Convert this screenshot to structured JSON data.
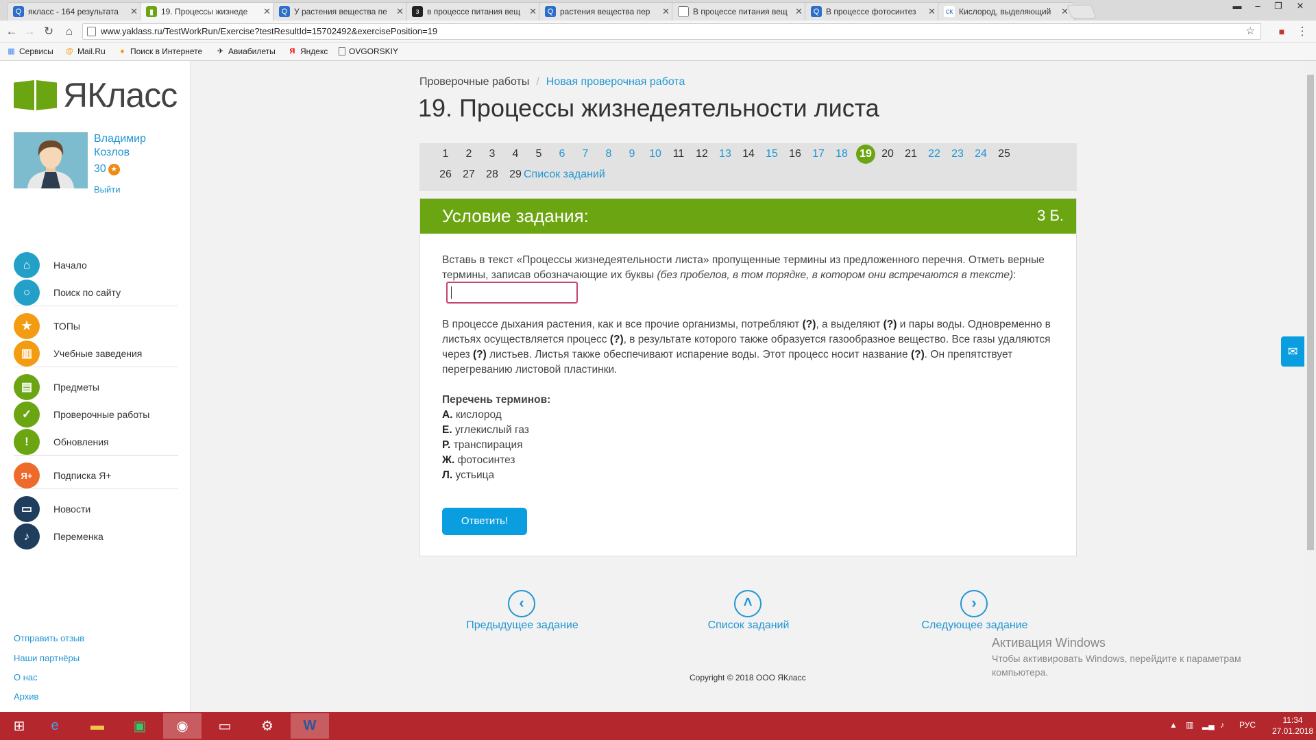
{
  "browser": {
    "tabs": [
      {
        "title": "якласс - 164 результата",
        "icon": "search-icon",
        "active": false
      },
      {
        "title": "19. Процессы жизнеде",
        "icon": "yaklass-icon",
        "active": true
      },
      {
        "title": "У растения вещества пе",
        "icon": "search-icon",
        "active": false
      },
      {
        "title": "в процессе питания вещ",
        "icon": "z-icon",
        "active": false
      },
      {
        "title": "растения вещества пер",
        "icon": "search-icon",
        "active": false
      },
      {
        "title": "В процессе питания вещ",
        "icon": "document-icon",
        "active": false
      },
      {
        "title": "В процессе фотосинтез",
        "icon": "search-icon",
        "active": false
      },
      {
        "title": "Кислород, выделяющий",
        "icon": "sk-icon",
        "active": false
      }
    ],
    "url": "www.yaklass.ru/TestWorkRun/Exercise?testResultId=15702492&exercisePosition=19",
    "bookmarks": [
      "Сервисы",
      "Mail.Ru",
      "Поиск в Интернете",
      "Авиабилеты",
      "Яндекс",
      "OVGORSKIY"
    ]
  },
  "sidebar": {
    "logo_text": "ЯКласс",
    "user_name": "Владимир Козлов",
    "user_points": "30",
    "logout": "Выйти",
    "menu": [
      {
        "label": "Начало",
        "icon": "home-icon",
        "color": "#22a0c8"
      },
      {
        "label": "Поиск по сайту",
        "icon": "search-icon",
        "color": "#22a0c8"
      },
      {
        "label": "ТОПы",
        "icon": "star-icon",
        "color": "#f39c12"
      },
      {
        "label": "Учебные заведения",
        "icon": "building-icon",
        "color": "#f39c12"
      },
      {
        "label": "Предметы",
        "icon": "book-icon",
        "color": "#6ba512"
      },
      {
        "label": "Проверочные работы",
        "icon": "check-icon",
        "color": "#6ba512"
      },
      {
        "label": "Обновления",
        "icon": "exclamation-icon",
        "color": "#6ba512"
      },
      {
        "label": "Подписка Я+",
        "icon": "yaplus-icon",
        "color": "#ee6a2a"
      },
      {
        "label": "Новости",
        "icon": "chat-icon",
        "color": "#1f3d5c"
      },
      {
        "label": "Переменка",
        "icon": "bell-icon",
        "color": "#1f3d5c"
      }
    ],
    "footer_links": [
      "Отправить отзыв",
      "Наши партнёры",
      "О нас",
      "Архив"
    ]
  },
  "breadcrumb": {
    "first": "Проверочные работы",
    "separator": "/",
    "second": "Новая проверочная работа"
  },
  "page_title": "19. Процессы жизнедеятельности листа",
  "pager": {
    "numbers": [
      {
        "n": "1",
        "state": "done"
      },
      {
        "n": "2",
        "state": "done"
      },
      {
        "n": "3",
        "state": "done"
      },
      {
        "n": "4",
        "state": "done"
      },
      {
        "n": "5",
        "state": "done"
      },
      {
        "n": "6",
        "state": "todo"
      },
      {
        "n": "7",
        "state": "todo"
      },
      {
        "n": "8",
        "state": "todo"
      },
      {
        "n": "9",
        "state": "todo"
      },
      {
        "n": "10",
        "state": "todo"
      },
      {
        "n": "11",
        "state": "done"
      },
      {
        "n": "12",
        "state": "done"
      },
      {
        "n": "13",
        "state": "todo"
      },
      {
        "n": "14",
        "state": "done"
      },
      {
        "n": "15",
        "state": "todo"
      },
      {
        "n": "16",
        "state": "done"
      },
      {
        "n": "17",
        "state": "todo"
      },
      {
        "n": "18",
        "state": "todo"
      },
      {
        "n": "19",
        "state": "current"
      },
      {
        "n": "20",
        "state": "done"
      },
      {
        "n": "21",
        "state": "done"
      },
      {
        "n": "22",
        "state": "todo"
      },
      {
        "n": "23",
        "state": "todo"
      },
      {
        "n": "24",
        "state": "todo"
      },
      {
        "n": "25",
        "state": "done"
      },
      {
        "n": "26",
        "state": "done"
      },
      {
        "n": "27",
        "state": "done"
      },
      {
        "n": "28",
        "state": "done"
      },
      {
        "n": "29",
        "state": "done"
      }
    ],
    "list_link": "Список заданий"
  },
  "task": {
    "header": "Условие задания:",
    "points": "3 Б.",
    "instruction_plain": "Вставь в текст «Процессы жизнедеятельности листа» пропущенные термины из предложенного перечня. Отметь верные термины, записав обозначающие их буквы",
    "instruction_italic": "(без пробелов, в том порядке, в котором они встречаются в тексте)",
    "instruction_colon": ":",
    "answer_value": "",
    "text_parts": [
      "В процессе дыхания растения, как и все прочие организмы, потребляют ",
      "(?)",
      ", а выделяют ",
      "(?)",
      " и пары воды. Одновременно в листьях осуществляется процесс ",
      "(?)",
      ", в результате которого также образуется газообразное вещество. Все газы удаляются через ",
      "(?)",
      " листьев. Листья также обеспечивают испарение воды. Этот процесс носит название ",
      "(?)",
      ". Он препятствует перегреванию листовой пластинки."
    ],
    "terms_title": "Перечень терминов:",
    "terms": [
      {
        "letter": "А.",
        "text": "кислород"
      },
      {
        "letter": "Е.",
        "text": "углекислый газ"
      },
      {
        "letter": "Р.",
        "text": "транспирация"
      },
      {
        "letter": "Ж.",
        "text": "фотосинтез"
      },
      {
        "letter": "Л.",
        "text": "устьица"
      }
    ],
    "submit": "Ответить!"
  },
  "navigation": {
    "prev": "Предыдущее задание",
    "list": "Список заданий",
    "next": "Следующее задание"
  },
  "copyright": "Copyright © 2018 ООО ЯКласс",
  "activation": {
    "title": "Активация Windows",
    "text": "Чтобы активировать Windows, перейдите к параметрам компьютера."
  },
  "taskbar": {
    "language": "РУС",
    "time": "11:34",
    "date": "27.01.2018"
  }
}
